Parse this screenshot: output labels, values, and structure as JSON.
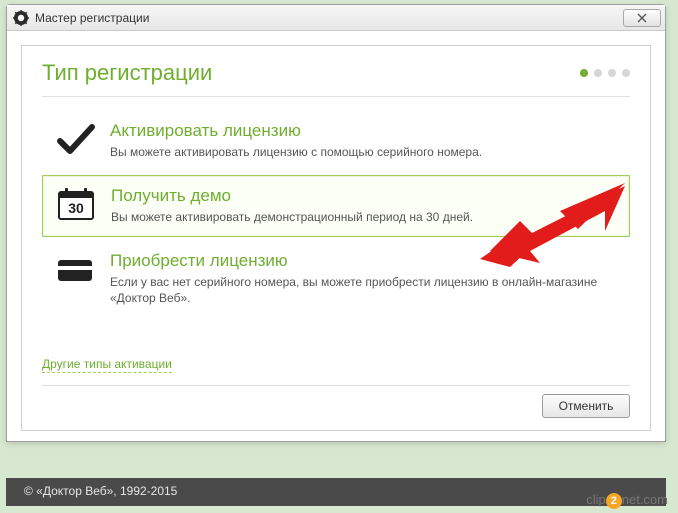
{
  "window": {
    "title": "Мастер регистрации"
  },
  "page": {
    "title": "Тип регистрации"
  },
  "options": {
    "activate": {
      "title": "Активировать лицензию",
      "desc": "Вы можете активировать лицензию с помощью серийного номера."
    },
    "demo": {
      "title": "Получить демо",
      "desc": "Вы можете активировать демонстрационный период на 30 дней.",
      "calendar_day": "30"
    },
    "buy": {
      "title": "Приобрести лицензию",
      "desc": "Если у вас нет серийного номера, вы можете приобрести лицензию в онлайн-магазине «Доктор Веб»."
    }
  },
  "links": {
    "other": "Другие типы активации"
  },
  "buttons": {
    "cancel": "Отменить"
  },
  "footer": {
    "copyright": "© «Доктор Веб», 1992-2015"
  },
  "watermark": {
    "prefix": "clip",
    "mid": "2",
    "suffix": "net.com"
  }
}
